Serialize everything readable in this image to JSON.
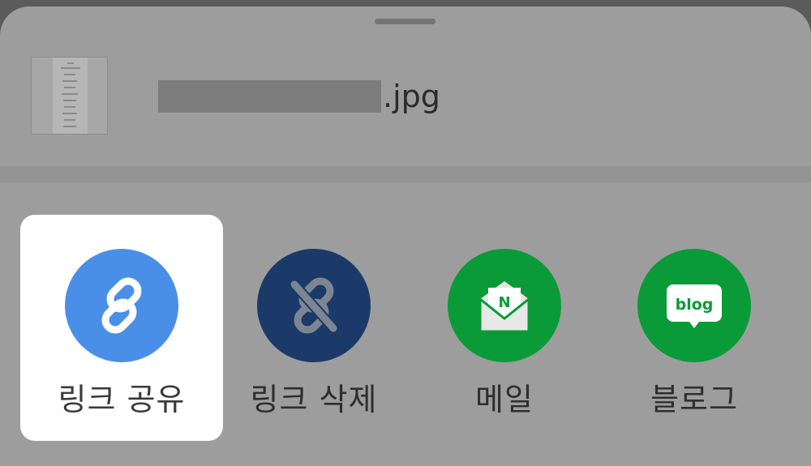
{
  "file": {
    "extension": ".jpg"
  },
  "actions": [
    {
      "id": "link-share",
      "label": "링크 공유",
      "icon": "link-icon",
      "color": "#4a8fe7",
      "selected": true
    },
    {
      "id": "link-delete",
      "label": "링크 삭제",
      "icon": "unlink-icon",
      "color": "#1b3a69",
      "selected": false
    },
    {
      "id": "mail",
      "label": "메일",
      "icon": "naver-mail-icon",
      "icon_text": "N",
      "color": "#0a9b38",
      "selected": false
    },
    {
      "id": "blog",
      "label": "블로그",
      "icon": "naver-blog-icon",
      "icon_text": "blog",
      "color": "#0a9b38",
      "selected": false
    }
  ]
}
